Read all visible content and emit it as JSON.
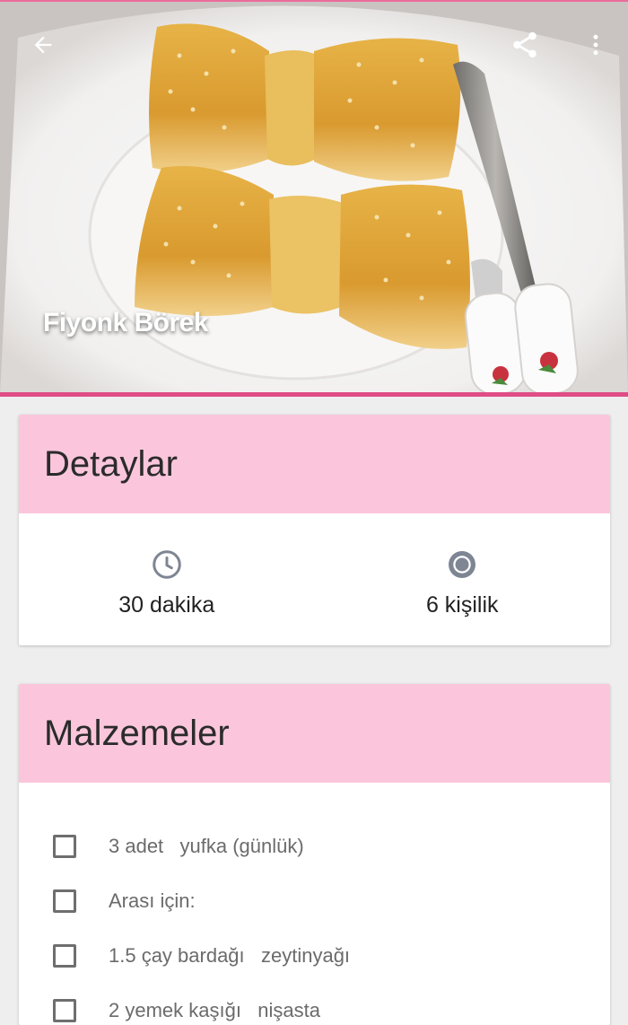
{
  "recipe": {
    "title": "Fiyonk Börek",
    "hero_image": "bow-shaped-sesame-pastry-photo"
  },
  "toolbar": {
    "back_icon": "arrow-left-icon",
    "share_icon": "share-icon",
    "more_icon": "more-vert-icon"
  },
  "details": {
    "header": "Detaylar",
    "time": "30 dakika",
    "servings": "6 kişilik"
  },
  "ingredients": {
    "header": "Malzemeler",
    "items": [
      {
        "text": "3 adet   yufka (günlük)",
        "checked": false
      },
      {
        "text": "Arası için:",
        "checked": false
      },
      {
        "text": "1.5 çay bardağı   zeytinyağı",
        "checked": false
      },
      {
        "text": "2 yemek kaşığı   nişasta",
        "checked": false
      }
    ]
  },
  "colors": {
    "accent": "#e04c86",
    "card_header": "#fbc6dc",
    "background": "#eeeeee"
  }
}
